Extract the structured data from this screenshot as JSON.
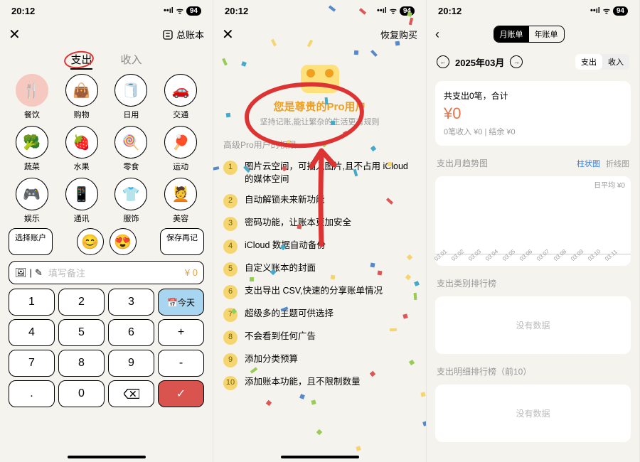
{
  "status": {
    "time": "20:12",
    "signal": "••ıl",
    "wifi": "ᯤ",
    "battery": "94"
  },
  "s1": {
    "ledger": "总账本",
    "tabs": {
      "expense": "支出",
      "income": "收入"
    },
    "cats": [
      {
        "id": "food",
        "label": "餐饮",
        "icon": "🍴"
      },
      {
        "id": "shop",
        "label": "购物",
        "icon": "👜"
      },
      {
        "id": "daily",
        "label": "日用",
        "icon": "🧻"
      },
      {
        "id": "transport",
        "label": "交通",
        "icon": "🚗"
      },
      {
        "id": "veg",
        "label": "蔬菜",
        "icon": "🥦"
      },
      {
        "id": "fruit",
        "label": "水果",
        "icon": "🍓"
      },
      {
        "id": "snack",
        "label": "零食",
        "icon": "🍭"
      },
      {
        "id": "sport",
        "label": "运动",
        "icon": "🏓"
      },
      {
        "id": "fun",
        "label": "娱乐",
        "icon": "🎮"
      },
      {
        "id": "comm",
        "label": "通讯",
        "icon": "📱"
      },
      {
        "id": "clothes",
        "label": "服饰",
        "icon": "👕"
      },
      {
        "id": "beauty",
        "label": "美容",
        "icon": "💆"
      }
    ],
    "cats2": [
      {
        "icon": "😊"
      },
      {
        "icon": "😍"
      }
    ],
    "select_account": "选择账户",
    "save_again": "保存再记",
    "note_ph": "填写备注",
    "amount": "¥ 0",
    "keys": [
      "1",
      "2",
      "3",
      "today",
      "4",
      "5",
      "6",
      "+",
      "7",
      "8",
      "9",
      "-",
      ".",
      "0",
      "del",
      "ok"
    ],
    "today": "今天"
  },
  "s2": {
    "restore": "恢复购买",
    "title": "您是尊贵的Pro用户",
    "subtitle": "坚持记账,能让繁杂的生活更有规则",
    "section": "高级Pro用户的权限",
    "perks": [
      "图片云空间，可插入图片,且不占用 iCloud的媒体空间",
      "自动解锁未来新功能",
      "密码功能，让账本更加安全",
      "iCloud 数据自动备份",
      "自定义账本的封面",
      "支出导出 CSV,快速的分享账单情况",
      "超级多的主题可供选择",
      "不会看到任何广告",
      "添加分类预算",
      "添加账本功能，且不限制数量"
    ]
  },
  "s3": {
    "seg": {
      "month": "月账单",
      "year": "年账单"
    },
    "month": "2025年03月",
    "seg2": {
      "expense": "支出",
      "income": "收入"
    },
    "summary_l1": "共支出0笔，合计",
    "summary_amt": "¥0",
    "summary_l2": "0笔收入 ¥0 | 结余 ¥0",
    "chart_h": "支出月趋势图",
    "chart_opts": {
      "bar": "柱状图",
      "line": "折线图"
    },
    "avg": "日平均 ¥0",
    "rank1_h": "支出类别排行榜",
    "rank2_h": "支出明细排行榜（前10）",
    "nodata": "没有数据"
  },
  "chart_data": {
    "type": "bar",
    "title": "支出月趋势图",
    "categories": [
      "03.01",
      "03.02",
      "03.03",
      "03.04",
      "03.05",
      "03.06",
      "03.07",
      "03.08",
      "03.09",
      "03.10",
      "03.11"
    ],
    "values": [
      0,
      0,
      0,
      0,
      0,
      0,
      0,
      0,
      0,
      0,
      0
    ],
    "ylabel": "",
    "xlabel": "",
    "ylim": [
      0,
      0
    ],
    "annotation": "日平均 ¥0"
  }
}
